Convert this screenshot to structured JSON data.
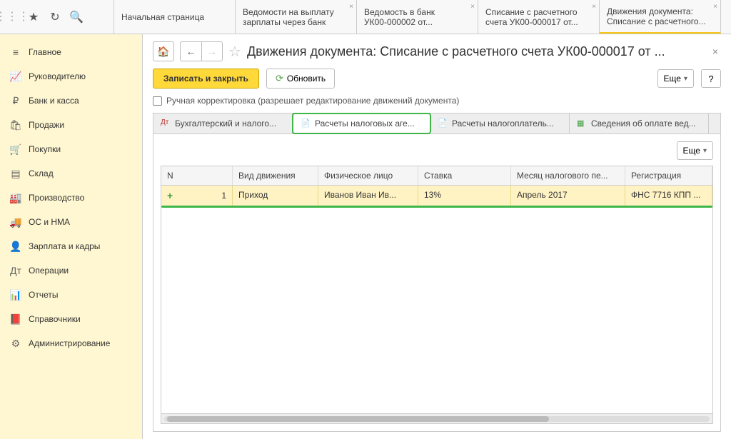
{
  "topbar": {
    "tabs": [
      {
        "l1": "Начальная страница",
        "l2": ""
      },
      {
        "l1": "Ведомости на выплату",
        "l2": "зарплаты через банк"
      },
      {
        "l1": "Ведомость в банк",
        "l2": "УК00-000002 от..."
      },
      {
        "l1": "Списание с расчетного",
        "l2": "счета УК00-000017 от..."
      },
      {
        "l1": "Движения документа:",
        "l2": "Списание с расчетного..."
      }
    ]
  },
  "sidebar": {
    "items": [
      "Главное",
      "Руководителю",
      "Банк и касса",
      "Продажи",
      "Покупки",
      "Склад",
      "Производство",
      "ОС и НМА",
      "Зарплата и кадры",
      "Операции",
      "Отчеты",
      "Справочники",
      "Администрирование"
    ]
  },
  "page": {
    "title": "Движения документа: Списание с расчетного счета УК00-000017 от ...",
    "save_close": "Записать и закрыть",
    "refresh": "Обновить",
    "more": "Еще",
    "help": "?",
    "checkbox_label": "Ручная корректировка (разрешает редактирование движений документа)"
  },
  "inner_tabs": [
    "Бухгалтерский и налого...",
    "Расчеты налоговых аге...",
    "Расчеты налогоплатель...",
    "Сведения об оплате вед..."
  ],
  "grid": {
    "headers": [
      "N",
      "Вид движения",
      "Физическое лицо",
      "Ставка",
      "Месяц налогового пе...",
      "Регистрация"
    ],
    "rows": [
      {
        "n": "1",
        "type": "Приход",
        "person": "Иванов Иван Ив...",
        "rate": "13%",
        "month": "Апрель 2017",
        "reg": "ФНС 7716 КПП ..."
      }
    ]
  }
}
